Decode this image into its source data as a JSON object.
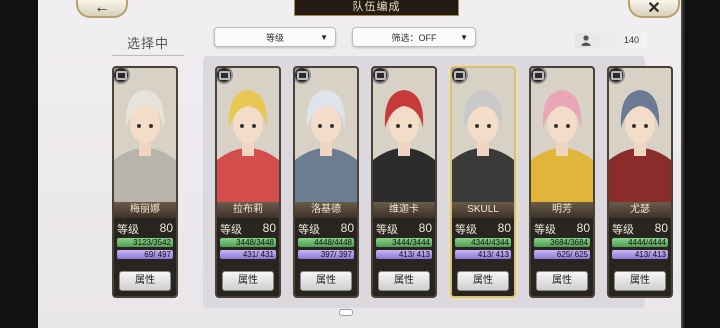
{
  "header": {
    "title": "队伍编成",
    "back_icon": "left-arrow-icon",
    "close_icon": "close-icon"
  },
  "selected_label": "选择中",
  "sort": {
    "value": "等级"
  },
  "filter": {
    "value": "筛选：OFF"
  },
  "unit_count": "140",
  "cards": [
    {
      "name": "梅丽娜",
      "level_label": "等级",
      "level": "80",
      "hp": "3123/3542",
      "mp": "69/ 497",
      "button": "属性",
      "highlighted": false,
      "hair": "#e8e3d8",
      "outfit": "#b9b4ab"
    },
    {
      "name": "拉布莉",
      "level_label": "等级",
      "level": "80",
      "hp": "3448/3448",
      "mp": "431/ 431",
      "button": "属性",
      "highlighted": false,
      "hair": "#e8c753",
      "outfit": "#d34d4d"
    },
    {
      "name": "洛基德",
      "level_label": "等级",
      "level": "80",
      "hp": "4448/4448",
      "mp": "397/ 397",
      "button": "属性",
      "highlighted": false,
      "hair": "#dfe4ea",
      "outfit": "#6d7d91"
    },
    {
      "name": "维迦卡",
      "level_label": "等级",
      "level": "80",
      "hp": "3444/3444",
      "mp": "413/ 413",
      "button": "属性",
      "highlighted": false,
      "hair": "#c73a3a",
      "outfit": "#2c2c2c"
    },
    {
      "name": "SKULL",
      "level_label": "等级",
      "level": "80",
      "hp": "4344/4344",
      "mp": "413/ 413",
      "button": "属性",
      "highlighted": true,
      "hair": "#c9c9c9",
      "outfit": "#3a3a3a"
    },
    {
      "name": "明芳",
      "level_label": "等级",
      "level": "80",
      "hp": "3684/3684",
      "mp": "625/ 625",
      "button": "属性",
      "highlighted": false,
      "hair": "#e8a6b6",
      "outfit": "#e1b43a"
    },
    {
      "name": "尤瑟",
      "level_label": "等级",
      "level": "80",
      "hp": "4444/4444",
      "mp": "413/ 413",
      "button": "属性",
      "highlighted": false,
      "hair": "#6c7b94",
      "outfit": "#8b2c2c"
    }
  ]
}
